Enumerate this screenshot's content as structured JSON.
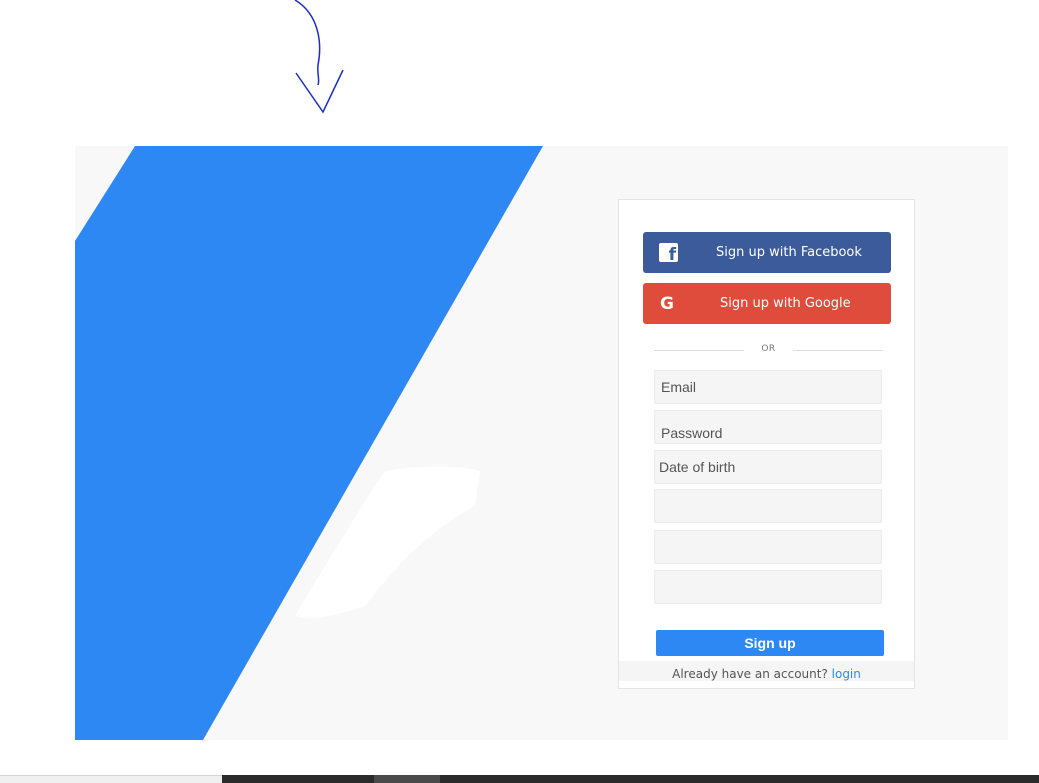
{
  "social": {
    "facebook_label": "Sign up with Facebook",
    "google_label": "Sign up with Google",
    "facebook_icon": "facebook-icon",
    "google_icon": "google-icon",
    "facebook_color": "#3b5b9b",
    "google_color": "#df4c3b"
  },
  "divider": {
    "text": "OR"
  },
  "form": {
    "email_placeholder": "Email",
    "password_placeholder": "Password",
    "dob_placeholder": "Date of birth",
    "field4_placeholder": "",
    "field5_placeholder": "",
    "field6_placeholder": ""
  },
  "signup": {
    "label": "Sign up",
    "color": "#2e88f3"
  },
  "login": {
    "prompt": "Already have an account? ",
    "link_label": "login"
  },
  "colors": {
    "accent_blue": "#2e88f3",
    "background": "#f8f8f8"
  },
  "annotation": {
    "icon": "hand-drawn-arrow-icon"
  }
}
